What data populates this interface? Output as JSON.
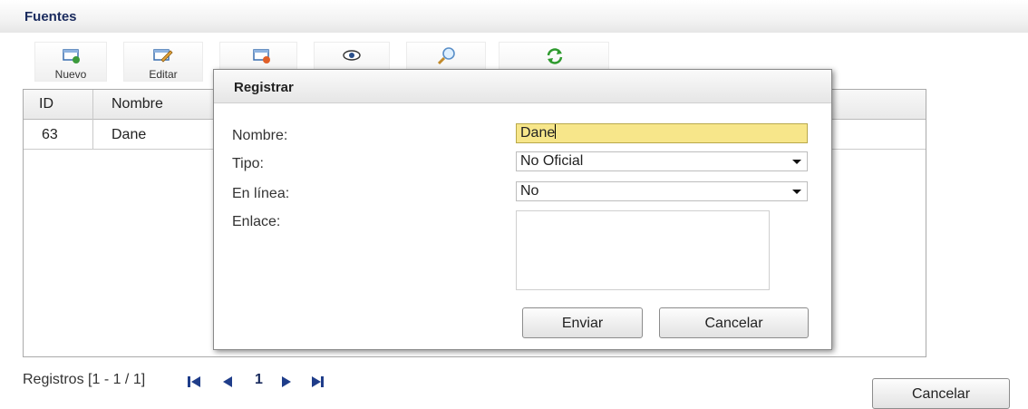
{
  "panel": {
    "title": "Fuentes"
  },
  "toolbar": {
    "nuevo_label": "Nuevo",
    "editar_label": "Editar",
    "icons": [
      "new-icon",
      "edit-icon",
      "delete-icon",
      "view-icon",
      "search-icon",
      "refresh-icon"
    ]
  },
  "grid": {
    "columns": [
      "ID",
      "Nombre"
    ],
    "rows": [
      {
        "id": "63",
        "nombre": "Dane"
      }
    ]
  },
  "pager": {
    "text": "Registros [1 - 1 / 1]",
    "page": "1"
  },
  "outer_cancel_label": "Cancelar",
  "dialog": {
    "title": "Registrar",
    "nombre_label": "Nombre:",
    "nombre_value": "Dane",
    "tipo_label": "Tipo:",
    "tipo_value": "No Oficial",
    "enlinea_label": "En línea:",
    "enlinea_value": "No",
    "enlace_label": "Enlace:",
    "enlace_value": "",
    "enviar_label": "Enviar",
    "cancelar_label": "Cancelar"
  },
  "colors": {
    "title_text": "#1a2b5e",
    "focused_input": "#f7e68a",
    "refresh_icon": "#2e9a2e"
  }
}
